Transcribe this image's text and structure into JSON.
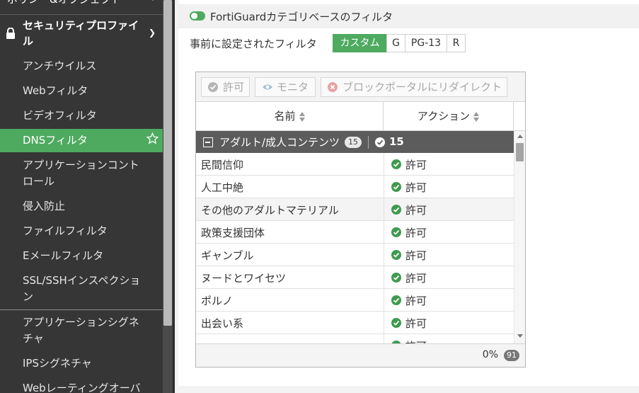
{
  "sidebar": {
    "top_item": "ポリシー&オブジェクト",
    "section_title": "セキュリティプロファイル",
    "items": [
      {
        "label": "アンチウイルス"
      },
      {
        "label": "Webフィルタ"
      },
      {
        "label": "ビデオフィルタ"
      },
      {
        "label": "DNSフィルタ"
      },
      {
        "label": "アプリケーションコントロール",
        "line1": "アプリケーションコント",
        "line2": "ロール"
      },
      {
        "label": "侵入防止"
      },
      {
        "label": "ファイルフィルタ"
      },
      {
        "label": "Eメールフィルタ"
      },
      {
        "label": "SSL/SSHインスペクション",
        "line1": "SSL/SSHインスペクショ",
        "line2": "ン"
      },
      {
        "label": "アプリケーションシグネチャ",
        "line1": "アプリケーションシグネ",
        "line2": "チャ"
      },
      {
        "label": "IPSシグネチャ"
      },
      {
        "label": "Webレーティングオーバ"
      }
    ],
    "active_index": 3
  },
  "main": {
    "toggle_on": true,
    "section_title": "FortiGuardカテゴリベースのフィルタ",
    "preset_label": "事前に設定されたフィルタ",
    "presets": [
      "カスタム",
      "G",
      "PG-13",
      "R"
    ],
    "active_preset": "カスタム",
    "toolbar": {
      "allow": "許可",
      "monitor": "モニタ",
      "redirect": "ブロックポータルにリダイレクト"
    },
    "columns": {
      "name": "名前",
      "action": "アクション"
    },
    "group": {
      "name": "アダルト/成人コンテンツ",
      "badge": "15",
      "allowed_count": "15"
    },
    "rows": [
      {
        "name": "民間信仰",
        "action": "許可"
      },
      {
        "name": "人工中絶",
        "action": "許可"
      },
      {
        "name": "その他のアダルトマテリアル",
        "action": "許可"
      },
      {
        "name": "政策支援団体",
        "action": "許可"
      },
      {
        "name": "ギャンブル",
        "action": "許可"
      },
      {
        "name": "ヌードとワイセツ",
        "action": "許可"
      },
      {
        "name": "ポルノ",
        "action": "許可"
      },
      {
        "name": "出会い系",
        "action": "許可"
      },
      {
        "name": "",
        "action": "許可"
      }
    ],
    "footer": {
      "percent": "0%",
      "count": "91"
    }
  },
  "colors": {
    "accent": "#4eaa5f",
    "sidebar_bg": "#363636",
    "group_bg": "#5c5c5c"
  }
}
